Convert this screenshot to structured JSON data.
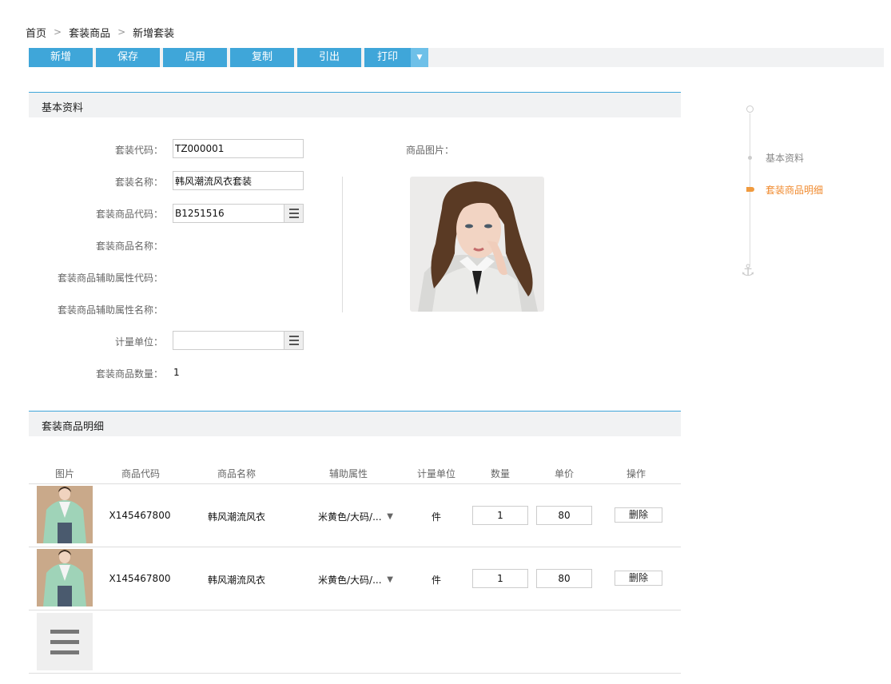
{
  "breadcrumb": [
    "首页",
    "套装商品",
    "新增套装"
  ],
  "toolbar": {
    "buttons": [
      "新增",
      "保存",
      "启用",
      "复制",
      "引出",
      "打印"
    ]
  },
  "sections": {
    "basic": "基本资料",
    "detail": "套装商品明细"
  },
  "form": {
    "code_label": "套装代码：",
    "code_value": "TZ000001",
    "name_label": "套装名称：",
    "name_value": "韩风潮流风衣套装",
    "item_code_label": "套装商品代码：",
    "item_code_value": "B1251516",
    "item_name_label": "套装商品名称：",
    "aux_code_label": "套装商品辅助属性代码：",
    "aux_name_label": "套装商品辅助属性名称：",
    "unit_label": "计量单位：",
    "unit_value": "",
    "qty_label": "套装商品数量：",
    "qty_value": "1",
    "image_label": "商品图片："
  },
  "side_nav": [
    "基本资料",
    "套装商品明细"
  ],
  "table": {
    "headers": [
      "图片",
      "商品代码",
      "商品名称",
      "辅助属性",
      "计量单位",
      "数量",
      "单价",
      "操作"
    ],
    "rows": [
      {
        "code": "X145467800",
        "name": "韩风潮流风衣",
        "attr": "米黄色/大码/...",
        "unit": "件",
        "qty": "1",
        "price": "80",
        "action": "删除"
      },
      {
        "code": "X145467800",
        "name": "韩风潮流风衣",
        "attr": "米黄色/大码/...",
        "unit": "件",
        "qty": "1",
        "price": "80",
        "action": "删除"
      }
    ]
  },
  "colors": {
    "accent": "#3fa6d9",
    "active_nav": "#f08a2e",
    "header_bg": "#f1f2f3"
  }
}
